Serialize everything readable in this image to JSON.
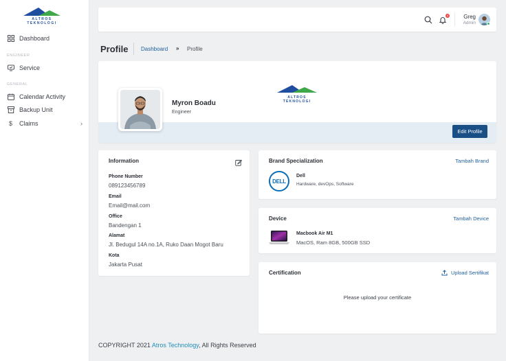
{
  "app": {
    "logo_text": "ALTROS TEKNOLOGI",
    "colors": {
      "primary": "#1a4f86",
      "accent_green": "#3ea84b",
      "link": "#1f5f9c"
    }
  },
  "sidebar": {
    "items": [
      {
        "label": "Dashboard",
        "icon": "grid-icon"
      },
      {
        "section": "ENGINEER"
      },
      {
        "label": "Service",
        "icon": "monitor-icon"
      },
      {
        "section": "GENERAL"
      },
      {
        "label": "Calendar Activity",
        "icon": "calendar-icon"
      },
      {
        "label": "Backup Unit",
        "icon": "archive-icon"
      },
      {
        "label": "Claims",
        "icon": "dollar-icon",
        "chevron": "›"
      }
    ]
  },
  "topbar": {
    "notification_count": "4",
    "user": {
      "name": "Greg",
      "role": "Admin"
    }
  },
  "page": {
    "title": "Profile",
    "breadcrumb": {
      "link": "Dashboard",
      "separator": "»",
      "current": "Profile"
    }
  },
  "profile": {
    "name": "Myron Boadu",
    "role": "Engineer",
    "edit_label": "Edit Profile"
  },
  "information": {
    "title": "Information",
    "fields": [
      {
        "label": "Phone Number",
        "value": "089123456789"
      },
      {
        "label": "Email",
        "value": "Email@mail.com"
      },
      {
        "label": "Office",
        "value": "Bandengan 1"
      },
      {
        "label": "Alamat",
        "value": "Jl. Bedugul 14A no.1A, Ruko Daan Mogot Baru"
      },
      {
        "label": "Kota",
        "value": "Jakarta Pusat"
      }
    ]
  },
  "brand": {
    "title": "Brand Specialization",
    "action": "Tambah Brand",
    "item": {
      "logo": "DELL",
      "name": "Dell",
      "skills": "Hardware, devOps, Software"
    }
  },
  "device": {
    "title": "Device",
    "action": "Tambah Device",
    "item": {
      "name": "Macbook Air M1",
      "specs": "MacOS, Ram 8GB, 500GB SSD"
    }
  },
  "certification": {
    "title": "Certification",
    "action": "Upload Sertifikat",
    "empty": "Please upload your certificate"
  },
  "footer": {
    "prefix": "COPYRIGHT 2021 ",
    "brand": "Atros Technology",
    "suffix": ", All Rights Reserved"
  }
}
